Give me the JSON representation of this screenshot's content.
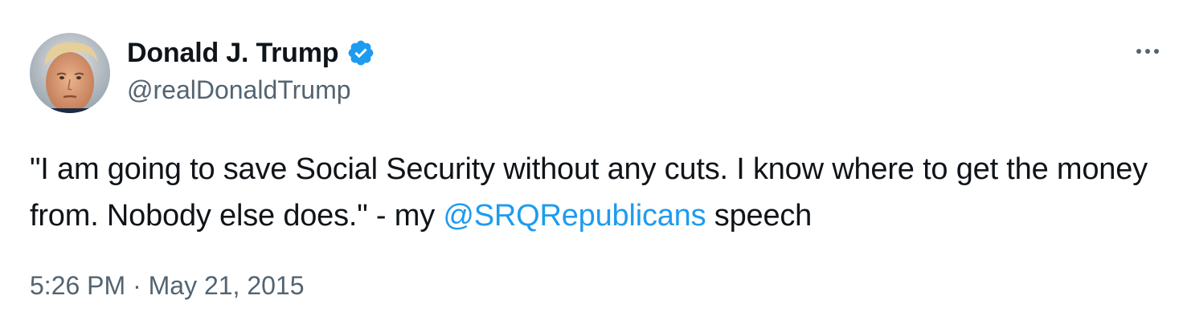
{
  "author": {
    "display_name": "Donald J. Trump",
    "handle": "@realDonaldTrump",
    "verified": true,
    "avatar_icon": "profile-photo",
    "verified_icon": "verified-badge-icon"
  },
  "menu": {
    "icon": "more-options-icon"
  },
  "tweet": {
    "text_before": "\"I am going to save Social Security without any cuts. I know where to get the money from. Nobody else does.\" - my ",
    "mention": "@SRQRepublicans",
    "text_after": " speech"
  },
  "meta": {
    "timestamp": "5:26 PM · May 21, 2015"
  },
  "colors": {
    "text": "#0f1419",
    "secondary": "#536471",
    "link": "#1d9bf0",
    "verified": "#1d9bf0"
  }
}
